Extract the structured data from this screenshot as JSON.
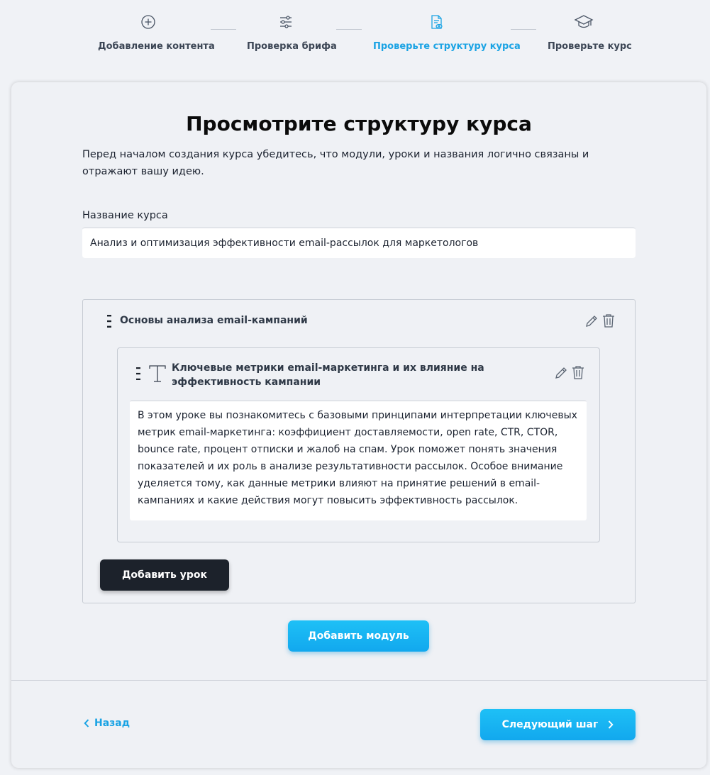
{
  "stepper": {
    "steps": [
      {
        "label": "Добавление контента",
        "icon": "plus-circle-icon"
      },
      {
        "label": "Проверка брифа",
        "icon": "sliders-icon"
      },
      {
        "label": "Проверьте структуру курса",
        "icon": "document-eye-icon",
        "active": true
      },
      {
        "label": "Проверьте курс",
        "icon": "graduation-cap-icon"
      }
    ],
    "accent_color": "#1aa3e4"
  },
  "page": {
    "title": "Просмотрите структуру курса",
    "description": "Перед началом создания курса убедитесь, что модули, уроки и названия логично связаны и отражают вашу идею."
  },
  "course": {
    "name_label": "Название курса",
    "name_value": "Анализ и оптимизация эффективности email-рассылок для маркетологов"
  },
  "modules": [
    {
      "title": "Основы анализа email-кампаний",
      "lessons": [
        {
          "title": "Ключевые метрики email-маркетинга и их влияние на эффективность кампании",
          "description": "В этом уроке вы познакомитесь с базовыми принципами интерпретации ключевых метрик email-маркетинга: коэффициент доставляемости, open rate, CTR, CTOR, bounce rate, процент отписки и жалоб на спам. Урок поможет понять значения показателей и их роль в анализе результативности рассылок. Особое внимание уделяется тому, как данные метрики влияют на принятие решений в email-кампаниях и какие действия могут повысить эффективность рассылок."
        }
      ],
      "add_lesson_label": "Добавить урок"
    }
  ],
  "actions": {
    "add_module_label": "Добавить модуль",
    "back_label": "Назад",
    "next_label": "Следующий шаг"
  }
}
